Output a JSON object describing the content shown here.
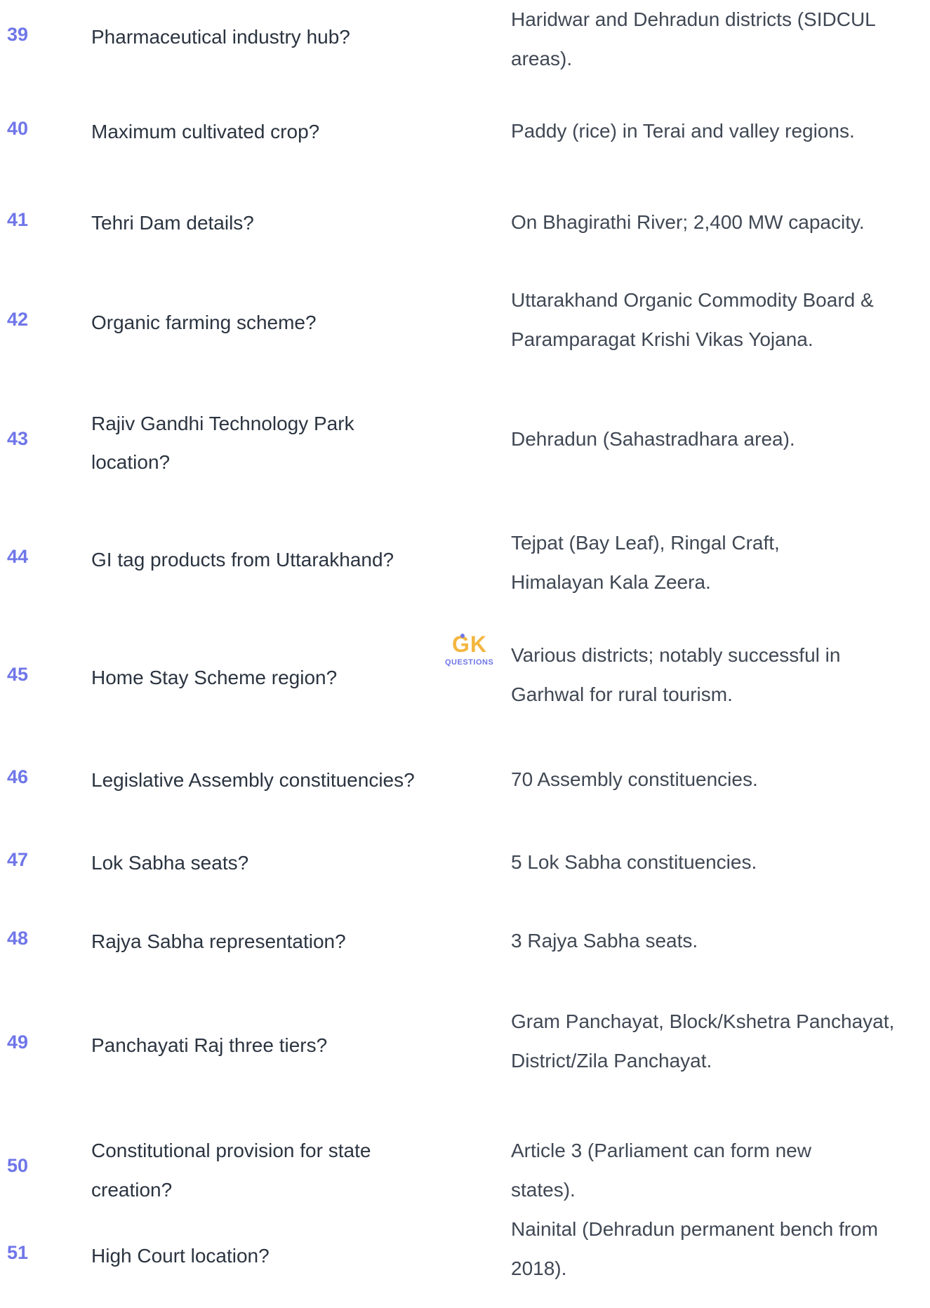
{
  "rows": [
    {
      "num": "39",
      "question": "Pharmaceutical industry hub?",
      "answer": "Haridwar and Dehradun districts (SIDCUL areas)."
    },
    {
      "num": "40",
      "question": "Maximum cultivated crop?",
      "answer": "Paddy (rice) in Terai and valley regions."
    },
    {
      "num": "41",
      "question": "Tehri Dam details?",
      "answer": "On Bhagirathi River; 2,400 MW capacity."
    },
    {
      "num": "42",
      "question": "Organic farming scheme?",
      "answer": "Uttarakhand Organic Commodity Board & Paramparagat Krishi Vikas Yojana."
    },
    {
      "num": "43",
      "question": "Rajiv Gandhi Technology Park location?",
      "answer": "Dehradun (Sahastradhara area)."
    },
    {
      "num": "44",
      "question": "GI tag products from Uttarakhand?",
      "answer": "Tejpat (Bay Leaf), Ringal Craft, Himalayan Kala Zeera."
    },
    {
      "num": "45",
      "question": "Home Stay Scheme region?",
      "answer": "Various districts; notably successful in Garhwal for rural tourism."
    },
    {
      "num": "46",
      "question": "Legislative Assembly constituencies?",
      "answer": "70 Assembly constituencies."
    },
    {
      "num": "47",
      "question": "Lok Sabha seats?",
      "answer": "5 Lok Sabha constituencies."
    },
    {
      "num": "48",
      "question": "Rajya Sabha representation?",
      "answer": "3 Rajya Sabha seats."
    },
    {
      "num": "49",
      "question": "Panchayati Raj three tiers?",
      "answer": "Gram Panchayat, Block/Kshetra Panchayat, District/Zila Panchayat."
    },
    {
      "num": "50",
      "question": "Constitutional provision for state creation?",
      "answer": "Article 3 (Parliament can form new states)."
    },
    {
      "num": "51",
      "question": "High Court location?",
      "answer": "Nainital (Dehradun permanent bench from 2018)."
    }
  ],
  "watermark": {
    "mark": "GK",
    "sub": "QUESTIONS"
  },
  "colors": {
    "number": "#6f76e8",
    "text": "#2b3440",
    "watermark_primary": "#f3b640",
    "watermark_secondary": "#6f76e8"
  }
}
